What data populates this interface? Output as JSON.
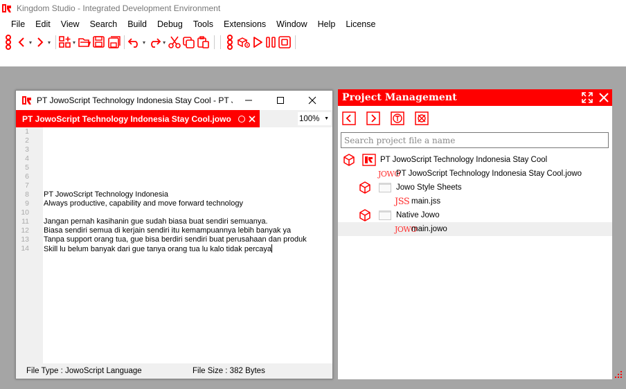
{
  "app": {
    "title": "Kingdom Studio - Integrated Development Environment"
  },
  "menu": [
    "File",
    "Edit",
    "View",
    "Search",
    "Build",
    "Debug",
    "Tools",
    "Extensions",
    "Window",
    "Help",
    "License"
  ],
  "toolbar_icons": [
    "back-icon",
    "forward-icon",
    "new-project-icon",
    "open-folder-icon",
    "save-icon",
    "save-all-icon",
    "undo-icon",
    "redo-icon",
    "cut-icon",
    "copy-icon",
    "paste-icon",
    "build-icon",
    "run-icon",
    "pause-icon",
    "stop-icon"
  ],
  "editor": {
    "window_title": "PT JowoScript Technology Indonesia Stay Cool - PT J...",
    "tab_label": "PT JowoScript Technology Indonesia Stay Cool.jowo",
    "zoom": "100%",
    "line_numbers": [
      "1",
      "2",
      "3",
      "4",
      "5",
      "6",
      "7",
      "8",
      "9",
      "10",
      "11",
      "12",
      "13",
      "14"
    ],
    "lines": [
      "",
      "",
      "",
      "",
      "",
      "",
      "",
      "PT JowoScript Technology Indonesia",
      "Always productive, capability and move forward technology",
      "",
      "Jangan pernah kasihanin gue sudah biasa buat sendiri semuanya.",
      "Biasa sendiri semua di kerjain sendiri itu kemampuannya lebih banyak ya",
      "Tanpa support orang tua, gue bisa berdiri sendiri buat perusahaan dan produk",
      "Skill lu belum banyak dari gue tanya orang tua lu kalo tidak percaya"
    ],
    "status": {
      "file_type": "File Type :  JowoScript Language",
      "file_size": "File Size :  382 Bytes"
    }
  },
  "project": {
    "title": "Project Management",
    "search_placeholder": "Search project file a name",
    "tree": [
      {
        "label": "PT JowoScript Technology Indonesia Stay Cool",
        "kind": "project"
      },
      {
        "label": "PT JowoScript Technology Indonesia Stay Cool.jowo",
        "kind": "jowo",
        "badge": "JOWO"
      },
      {
        "label": "Jowo Style Sheets",
        "kind": "folder"
      },
      {
        "label": "main.jss",
        "kind": "jss",
        "badge": "JSS"
      },
      {
        "label": "Native Jowo",
        "kind": "folder"
      },
      {
        "label": "main.jowo",
        "kind": "jowo",
        "badge": "JOWO",
        "selected": true
      }
    ]
  },
  "colors": {
    "accent": "#ff0000",
    "workspace": "#a5a5a5"
  }
}
